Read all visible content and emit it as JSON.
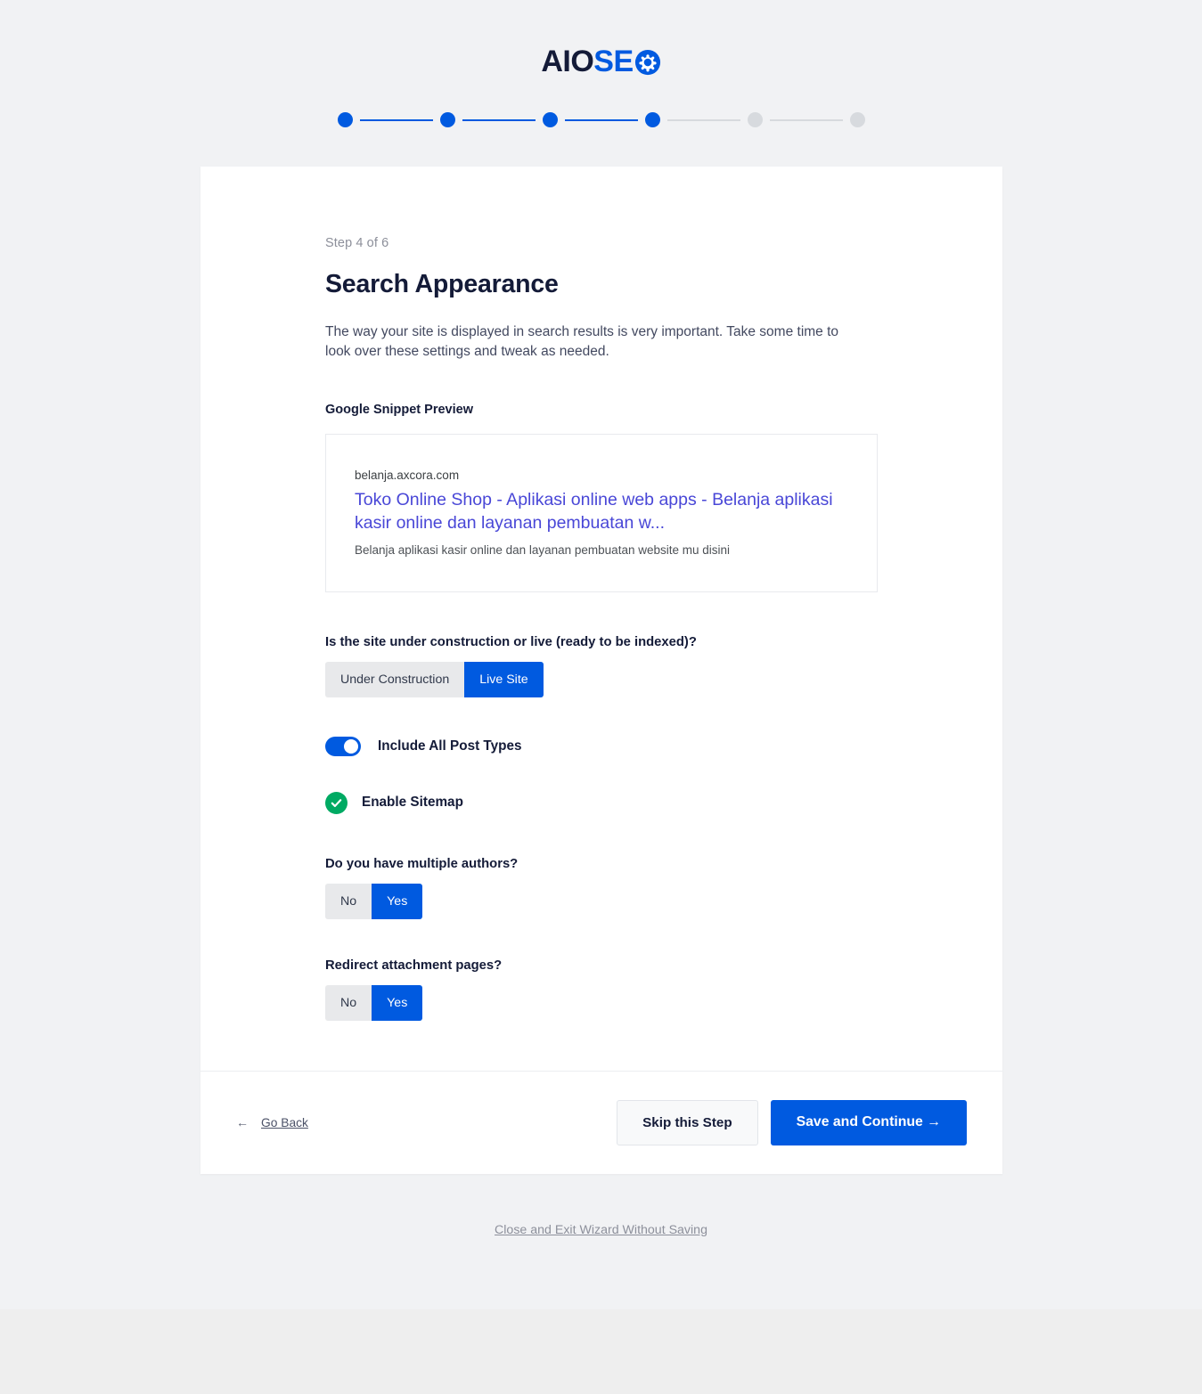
{
  "brand": {
    "logo_text_dark": "AIO",
    "logo_text_blue": "SE",
    "logo_icon": "gear-icon",
    "color_dark": "#141b38",
    "color_blue": "#005ae0"
  },
  "progress": {
    "total_steps": 6,
    "current_step": 4,
    "dots": [
      {
        "state": "active"
      },
      {
        "state": "active"
      },
      {
        "state": "active"
      },
      {
        "state": "active"
      },
      {
        "state": "inactive"
      },
      {
        "state": "inactive"
      }
    ],
    "active_color": "#005ae0",
    "inactive_color": "#d7dade"
  },
  "header": {
    "step_label": "Step 4 of 6",
    "title": "Search Appearance",
    "description": "The way your site is displayed in search results is very important. Take some time to look over these settings and tweak as needed."
  },
  "snippet": {
    "section_label": "Google Snippet Preview",
    "url": "belanja.axcora.com",
    "title": "Toko Online Shop - Aplikasi online web apps - Belanja aplikasi kasir online dan layanan pembuatan w...",
    "description": "Belanja aplikasi kasir online dan layanan pembuatan website mu disini",
    "title_color": "#4947d7"
  },
  "site_status": {
    "label": "Is the site under construction or live (ready to be indexed)?",
    "options": [
      "Under Construction",
      "Live Site"
    ],
    "selected": "Live Site"
  },
  "post_types": {
    "label": "Include All Post Types",
    "enabled": true
  },
  "sitemap": {
    "label": "Enable Sitemap",
    "enabled": true,
    "check_color": "#00aa63"
  },
  "multiple_authors": {
    "label": "Do you have multiple authors?",
    "options": [
      "No",
      "Yes"
    ],
    "selected": "Yes"
  },
  "redirect_attachments": {
    "label": "Redirect attachment pages?",
    "options": [
      "No",
      "Yes"
    ],
    "selected": "Yes"
  },
  "footer": {
    "back_arrow": "←",
    "back_label": "Go Back",
    "skip_label": "Skip this Step",
    "save_label": "Save and Continue →"
  },
  "exit": {
    "label": "Close and Exit Wizard Without Saving"
  }
}
